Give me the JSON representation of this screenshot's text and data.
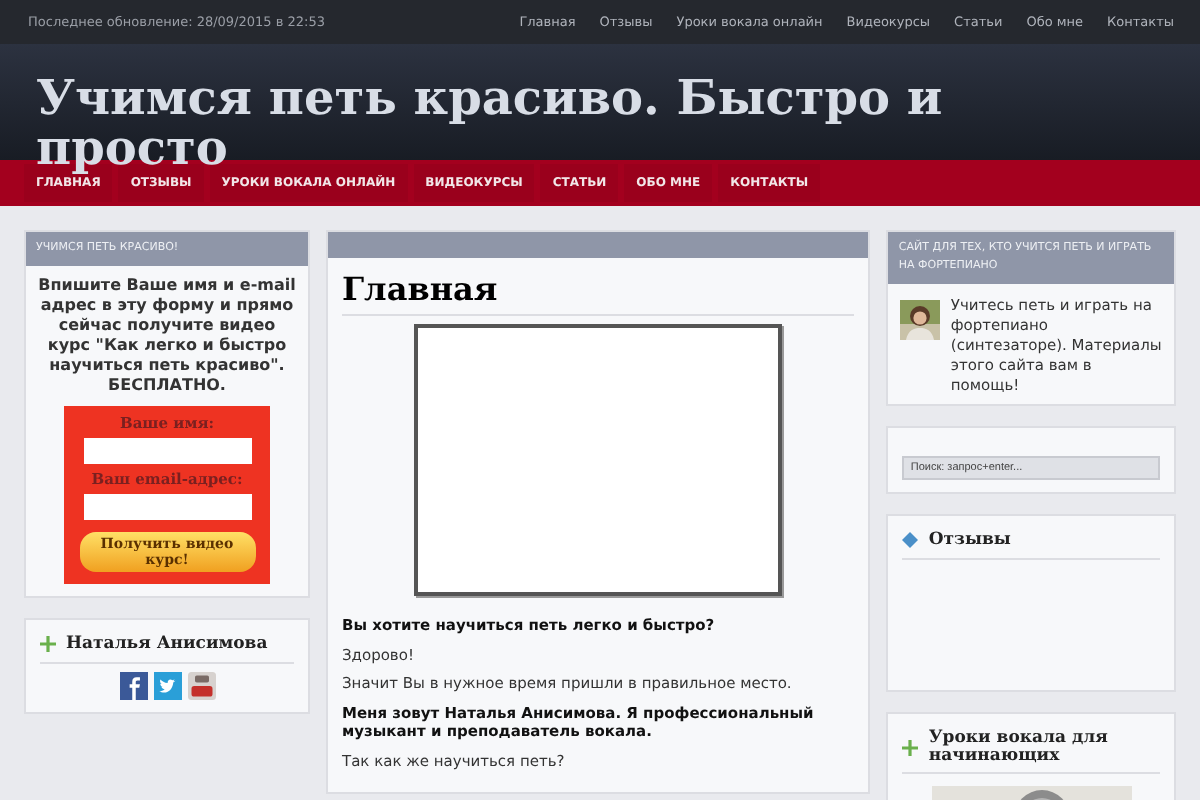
{
  "top_bar": {
    "last_update": "Последнее обновление: 28/09/2015 в 22:53",
    "links": [
      {
        "label": "Главная"
      },
      {
        "label": "Отзывы"
      },
      {
        "label": "Уроки вокала онлайн"
      },
      {
        "label": "Видеокурсы"
      },
      {
        "label": "Статьи"
      },
      {
        "label": "Обо мне"
      },
      {
        "label": "Контакты"
      }
    ]
  },
  "site_title": "Учимся петь красиво. Быстро и просто",
  "nav": [
    {
      "label": "ГЛАВНАЯ"
    },
    {
      "label": "ОТЗЫВЫ"
    },
    {
      "label": "УРОКИ ВОКАЛА ОНЛАЙН"
    },
    {
      "label": "ВИДЕОКУРСЫ"
    },
    {
      "label": "СТАТЬИ"
    },
    {
      "label": "ОБО МНЕ"
    },
    {
      "label": "КОНТАКТЫ"
    }
  ],
  "left_sidebar": {
    "signup": {
      "title": "УЧИМСЯ ПЕТЬ КРАСИВО!",
      "intro": "Впишите Ваше имя и e-mail адрес в эту форму и прямо сейчас получите видео курс \"Как легко и быстро научиться петь красиво\". БЕСПЛАТНО.",
      "name_label": "Ваше имя:",
      "email_label": "Ваш email-адрес:",
      "button": "Получить видео курс!"
    },
    "author": {
      "title": "Наталья Анисимова"
    }
  },
  "main": {
    "page_title": "Главная",
    "paragraphs": [
      {
        "text": "Вы хотите научиться петь легко и быстро?",
        "bold": true
      },
      {
        "text": "Здорово!",
        "bold": false
      },
      {
        "text": "Значит Вы в нужное время пришли в правильное место.",
        "bold": false
      },
      {
        "text": "Меня зовут Наталья Анисимова. Я профессиональный музыкант и преподаватель вокала.",
        "bold": true
      },
      {
        "text": "Так как же научиться петь?",
        "bold": false
      }
    ]
  },
  "right_sidebar": {
    "about": {
      "title": "САЙТ ДЛЯ ТЕХ, КТО УЧИТСЯ ПЕТЬ И ИГРАТЬ НА ФОРТЕПИАНО",
      "text": "Учитесь петь и играть на фортепиано (синтезаторе). Материалы этого сайта вам в помощь!"
    },
    "search": {
      "placeholder": "Поиск: запрос+enter..."
    },
    "reviews": {
      "title": "Отзывы"
    },
    "lessons": {
      "title": "Уроки вокала для начинающих"
    }
  }
}
